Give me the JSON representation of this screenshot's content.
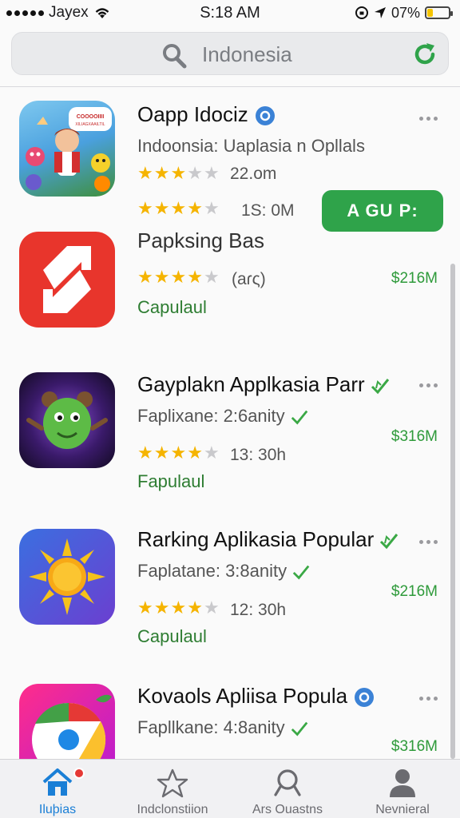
{
  "status": {
    "carrier": "Jayex",
    "time": "S:18 AM",
    "battery": "07%",
    "battery_level": 0.25
  },
  "search": {
    "placeholder": "Indonesia"
  },
  "apps": [
    {
      "title": "Oapp Idociz",
      "subtitle": "Indoonsia: Uaplasia n Opllals",
      "rating_text": "22.om",
      "rating_stars": 3,
      "meta2": "1S: 0M",
      "stars2": 4,
      "icon": "game-hero-icon",
      "icon_label_top": "COOOOIIII",
      "icon_label_bottom": "XILIAGXAAILTIL"
    },
    {
      "title": "Papksing Bas",
      "rating_text": "(aɾς)",
      "rating_stars": 4,
      "category": "Capulaul",
      "price": "$216M",
      "icon": "red-arrow-icon"
    },
    {
      "title": "Gayplakn Applkasia Parr",
      "subtitle": "Faplixane: 2:6anity",
      "rating_text": "13: 30h",
      "rating_stars": 4,
      "category": "Fapulaul",
      "price": "$316M",
      "icon": "monster-icon"
    },
    {
      "title": "Rarking Aplikasia Popular",
      "subtitle": "Faplatane: 3:8anity",
      "rating_text": "12: 30h",
      "rating_stars": 4,
      "category": "Capulaul",
      "price": "$216M",
      "icon": "sun-icon"
    },
    {
      "title": "Kovaols Apliisa Popula",
      "subtitle": "Fapllkane: 4:8anity",
      "price": "$316M",
      "icon": "chrome-icon"
    }
  ],
  "get_button": {
    "label": "A GU P:"
  },
  "tabs": [
    {
      "label": "Iluþias",
      "icon": "home-icon",
      "active": true
    },
    {
      "label": "Indclonstiion",
      "icon": "star-icon",
      "active": false
    },
    {
      "label": "Ars Ouastns",
      "icon": "search-icon",
      "active": false
    },
    {
      "label": "Nevnieral",
      "icon": "profile-icon",
      "active": false
    }
  ],
  "colors": {
    "accent_green": "#2fa34a",
    "star": "#f5b400",
    "tab_active": "#1a7fd6"
  }
}
